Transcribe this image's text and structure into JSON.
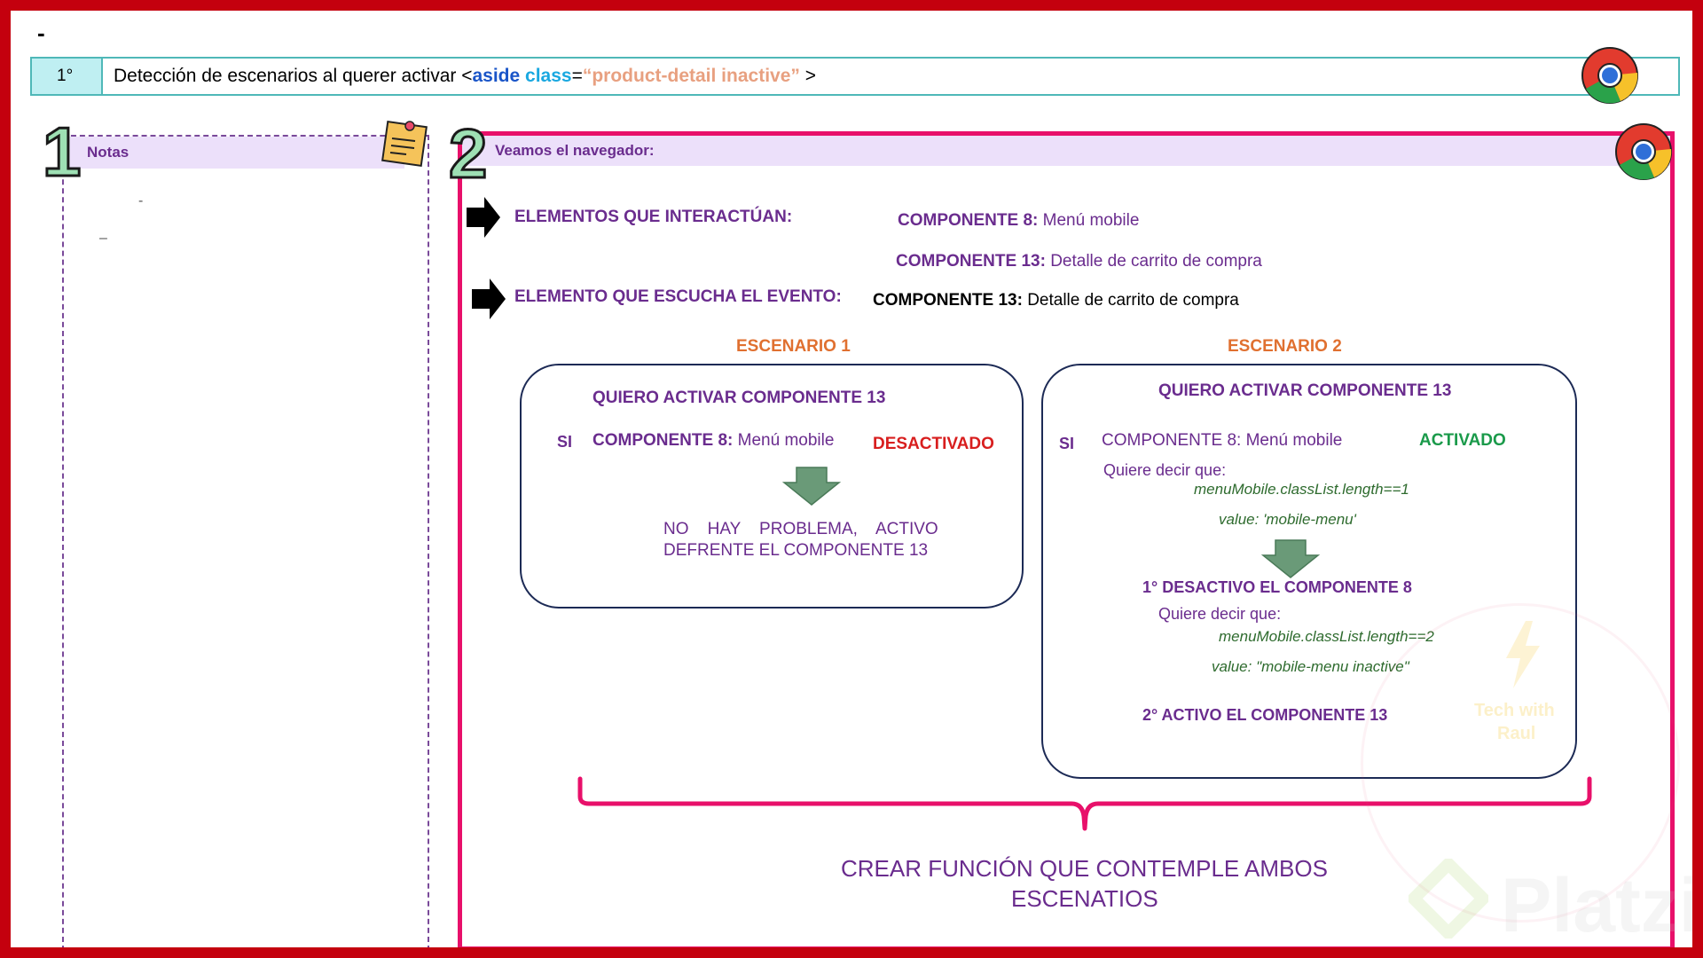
{
  "top_dash": "-",
  "header": {
    "step": "1°",
    "title_prefix": "Detección de escenarios al querer activar <",
    "tag": "aside",
    "attr": "class",
    "equals": "=",
    "value": "“product-detail inactive”",
    "suffix": " >"
  },
  "notes": {
    "number": "1",
    "title": "Notas",
    "dash1": "-",
    "dash2": "–"
  },
  "browser": {
    "number": "2",
    "title": "Veamos el navegador:",
    "interact_label": "ELEMENTOS QUE INTERACTÚAN:",
    "comp8_bold": "COMPONENTE 8:",
    "comp8_text": " Menú mobile",
    "comp13_bold": "COMPONENTE 13:",
    "comp13_text": " Detalle de carrito de compra",
    "listen_label": "ELEMENTO QUE ESCUCHA EL EVENTO:",
    "listen_bold": "COMPONENTE 13:",
    "listen_text": " Detalle de carrito de compra"
  },
  "scenario1": {
    "title": "ESCENARIO 1",
    "heading": "QUIERO ACTIVAR COMPONENTE 13",
    "si": "SI",
    "comp_bold": "COMPONENTE 8:",
    "comp_text": " Menú mobile",
    "status": "DESACTIVADO",
    "result_line1": "NO    HAY    PROBLEMA,    ACTIVO",
    "result_line2": "DEFRENTE EL COMPONENTE 13"
  },
  "scenario2": {
    "title": "ESCENARIO 2",
    "heading": "QUIERO ACTIVAR COMPONENTE 13",
    "si": "SI",
    "comp_text": "COMPONENTE 8: Menú mobile",
    "status": "ACTIVADO",
    "means1": "Quiere decir que:",
    "code1": "menuMobile.classList.length==1",
    "value1": "value: 'mobile-menu'",
    "step1": "1° DESACTIVO EL COMPONENTE 8",
    "means2": "Quiere decir que:",
    "code2": "menuMobile.classList.length==2",
    "value2": "value: \"mobile-menu inactive\"",
    "step2": "2° ACTIVO EL COMPONENTE 13"
  },
  "conclusion": {
    "line1": "CREAR FUNCIÓN QUE CONTEMPLE AMBOS",
    "line2": "ESCENATIOS"
  },
  "watermark": {
    "brand": "Platzi",
    "tech_line1": "Tech with",
    "tech_line2": "Raul"
  },
  "colors": {
    "frame": "#c4000e",
    "accent_pink": "#e8106a",
    "purple": "#6a2c8e",
    "orange": "#e07030",
    "red_status": "#d81e1e",
    "green_status": "#1a9a4a",
    "header_cyan": "#4fb8b8",
    "arrow_green": "#6a9a78"
  }
}
